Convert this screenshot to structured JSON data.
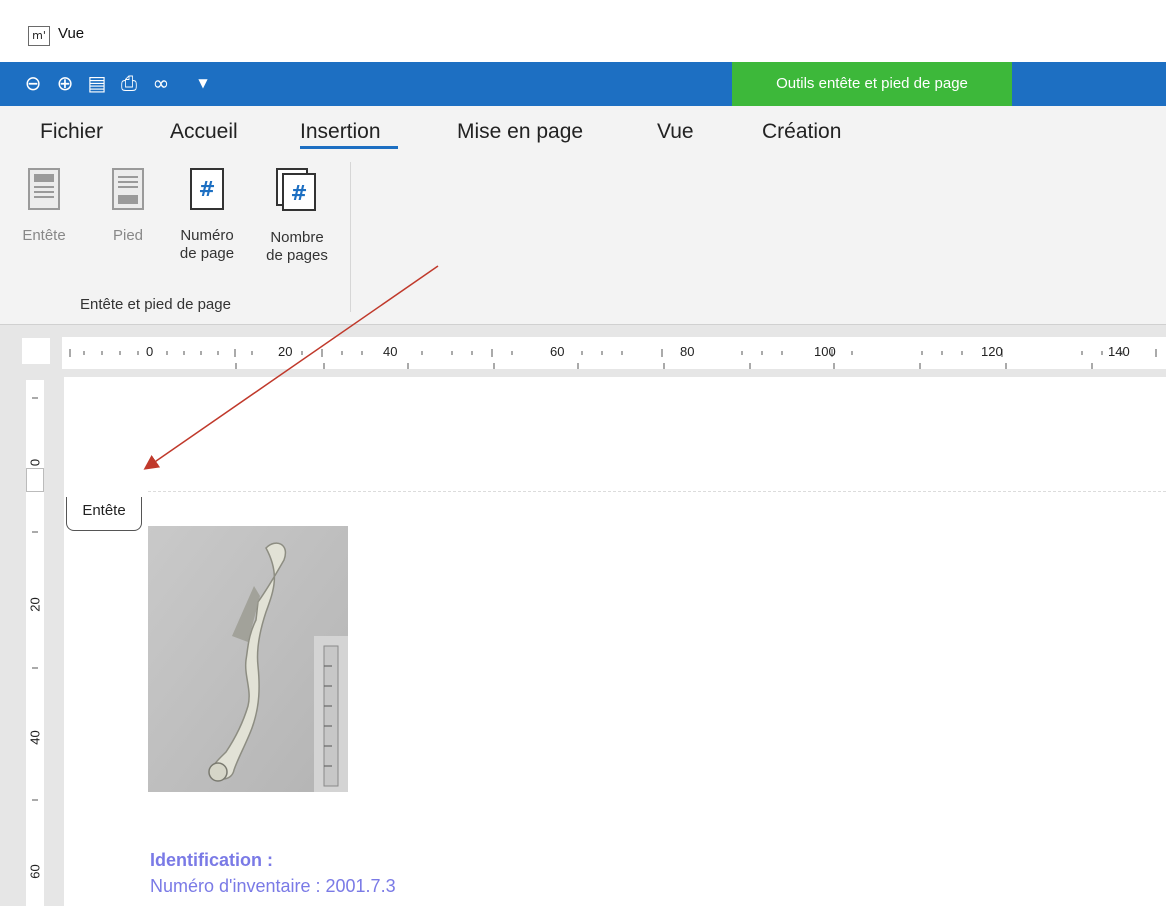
{
  "window": {
    "title": "Vue",
    "app_icon": "m'"
  },
  "quick_access": {
    "icons": [
      "zoom-out-icon",
      "zoom-in-icon",
      "page-view-icon",
      "print-icon",
      "find-icon",
      "dropdown-arrow-icon"
    ]
  },
  "context_tab": {
    "label": "Outils entête et pied de page",
    "color": "#3db83a"
  },
  "tabs": [
    "Fichier",
    "Accueil",
    "Insertion",
    "Mise en page",
    "Vue",
    "Création"
  ],
  "active_tab": "Insertion",
  "ribbon": {
    "buttons": [
      {
        "label": "Entête",
        "enabled": false
      },
      {
        "label": "Pied",
        "enabled": false
      },
      {
        "label": "Numéro de page",
        "line1": "Numéro",
        "line2": "de page",
        "enabled": true
      },
      {
        "label": "Nombre de pages",
        "line1": "Nombre",
        "line2": "de pages",
        "enabled": true
      }
    ],
    "group_label": "Entête et pied de page"
  },
  "ruler": {
    "horizontal_marks": [
      "0",
      "20",
      "40",
      "60",
      "80",
      "100",
      "120",
      "140"
    ],
    "vertical_marks": [
      "0",
      "20",
      "40",
      "60"
    ]
  },
  "document": {
    "header_tag": "Entête",
    "section_title": "Identification :",
    "inventory_line": "Numéro d'inventaire : 2001.7.3"
  },
  "colors": {
    "accent": "#1d6fc2",
    "context": "#3db83a",
    "annotation_arrow": "#c0392b",
    "text_accent": "#7a7ae6"
  }
}
